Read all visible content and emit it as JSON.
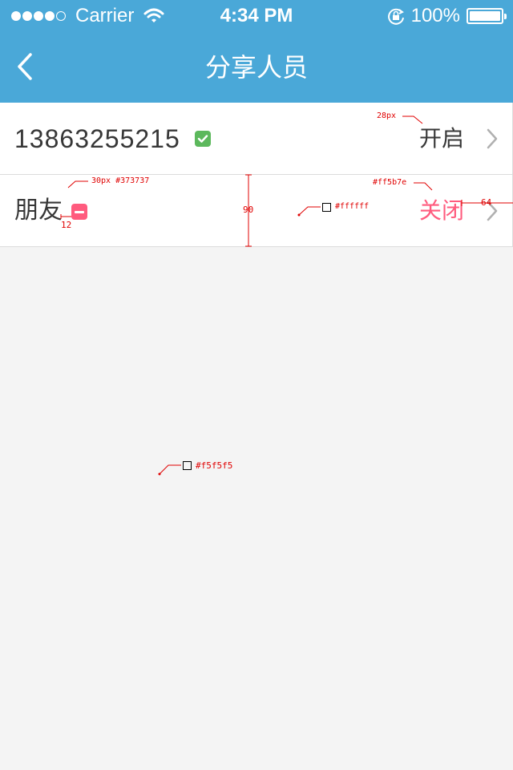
{
  "status_bar": {
    "carrier": "Carrier",
    "time": "4:34 PM",
    "battery": "100%",
    "signal_icon": "signal-dots-icon",
    "wifi_icon": "wifi-icon",
    "lock_icon": "rotation-lock-icon",
    "battery_icon": "battery-icon"
  },
  "nav": {
    "title": "分享人员",
    "back_icon": "back-chevron-icon"
  },
  "rows": [
    {
      "label": "13863255215",
      "status": "开启",
      "badge_icon": "check-icon",
      "chevron_icon": "chevron-right-icon"
    },
    {
      "label": "朋友",
      "status": "关闭",
      "badge_icon": "minus-icon",
      "chevron_icon": "chevron-right-icon"
    }
  ],
  "annotations": {
    "font_size_status": "28px",
    "font_spec": "30px #373737",
    "icon_gap": "12",
    "row_height": "90",
    "status_color": "#ff5b7e",
    "row_bg": "#ffffff",
    "right_padding": "64",
    "page_bg": "#f5f5f5"
  },
  "colors": {
    "header": "#4aa8d8",
    "text": "#373737",
    "closed": "#ff5b7e",
    "check": "#5cb85c",
    "page_bg": "#f4f4f4"
  }
}
